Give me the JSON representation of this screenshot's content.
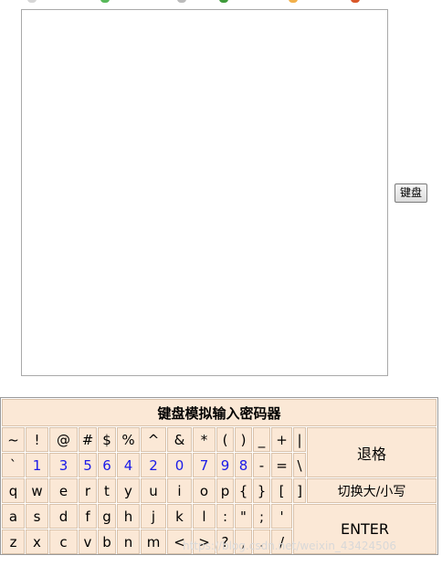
{
  "keyboard_toggle_label": "键盘",
  "keyboard": {
    "title": "键盘模拟输入密码器",
    "row1": [
      "~",
      "!",
      "@",
      "#",
      "$",
      "%",
      "^",
      "&",
      "*",
      "(",
      ")",
      "_",
      "+",
      "|"
    ],
    "row2": [
      "`",
      "1",
      "3",
      "5",
      "6",
      "4",
      "2",
      "0",
      "7",
      "9",
      "8",
      "-",
      "=",
      "\\"
    ],
    "row3": [
      "q",
      "w",
      "e",
      "r",
      "t",
      "y",
      "u",
      "i",
      "o",
      "p",
      "{",
      "}",
      "[",
      "]"
    ],
    "row4": [
      "a",
      "s",
      "d",
      "f",
      "g",
      "h",
      "j",
      "k",
      "l",
      ":",
      "\"",
      ";",
      "'"
    ],
    "row5": [
      "z",
      "x",
      "c",
      "v",
      "b",
      "n",
      "m",
      "<",
      ">",
      "?",
      ",",
      ".",
      "/"
    ],
    "backspace_label": "退格",
    "caps_label": "切换大/小写",
    "enter_label": "ENTER"
  },
  "watermark": "https://blog.csdn.net/weixin_43424506"
}
